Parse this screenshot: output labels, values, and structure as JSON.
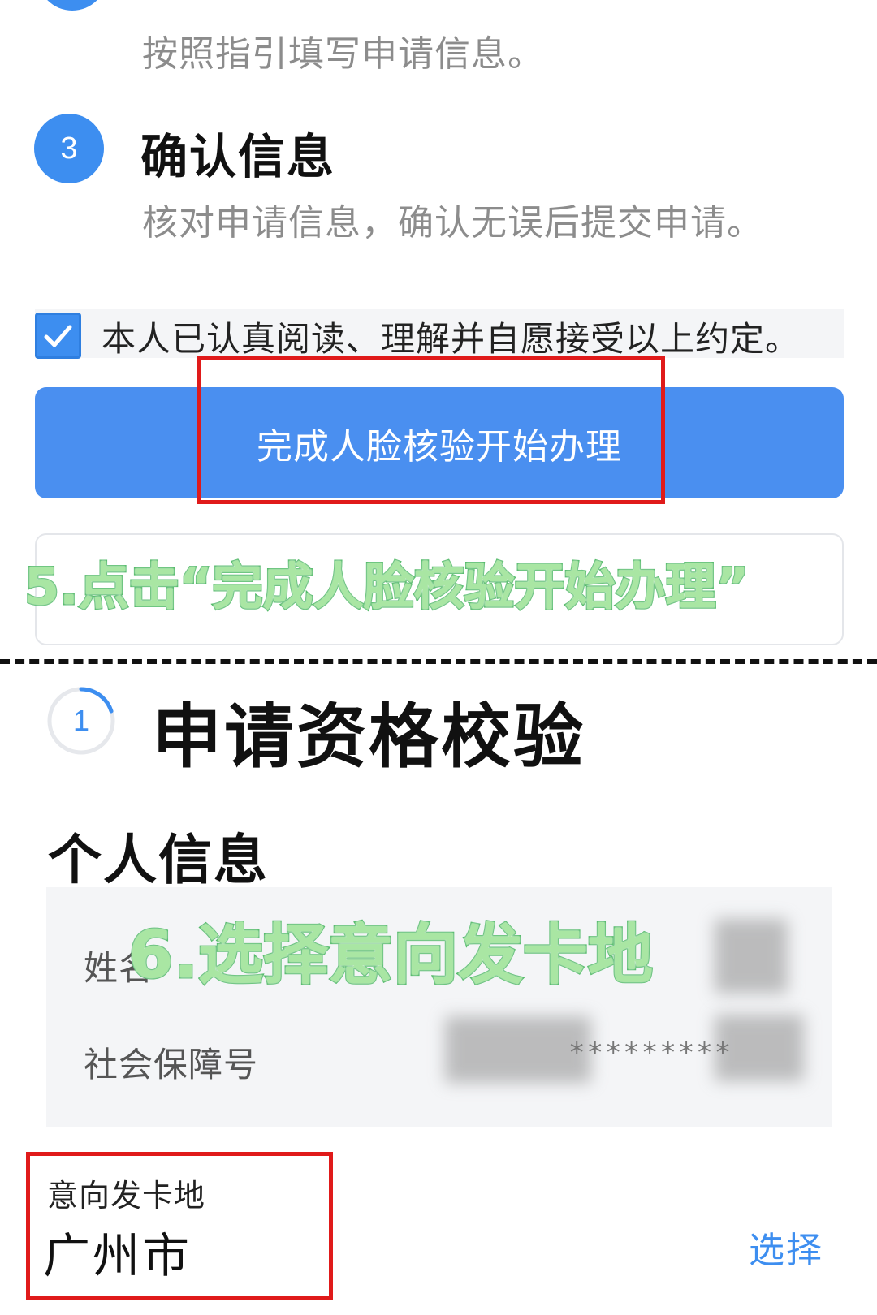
{
  "steps": [
    {
      "number": "3",
      "title": "确认信息",
      "desc": "核对申请信息，确认无误后提交申请。"
    }
  ],
  "prev_step": {
    "desc": "按照指引填写申请信息。"
  },
  "agreement": {
    "checked": true,
    "text": "本人已认真阅读、理解并自愿接受以上约定。"
  },
  "primary_button": {
    "label": "完成人脸核验开始办理"
  },
  "annotations": {
    "step5": "5.点击“完成人脸核验开始办理”",
    "step6": "6.选择意向发卡地"
  },
  "qualification": {
    "step_number": "1",
    "title": "申请资格校验"
  },
  "personal_info": {
    "title": "个人信息",
    "name_label": "姓名",
    "ssn_label": "社会保障号",
    "ssn_value": "*********"
  },
  "card_region": {
    "label": "意向发卡地",
    "value": "广州市",
    "select_label": "选择"
  },
  "colors": {
    "accent": "#3d8ef0",
    "highlight_box": "#e01a1a",
    "annotation_fill": "#a9e6a3",
    "annotation_stroke": "#4fb865"
  }
}
